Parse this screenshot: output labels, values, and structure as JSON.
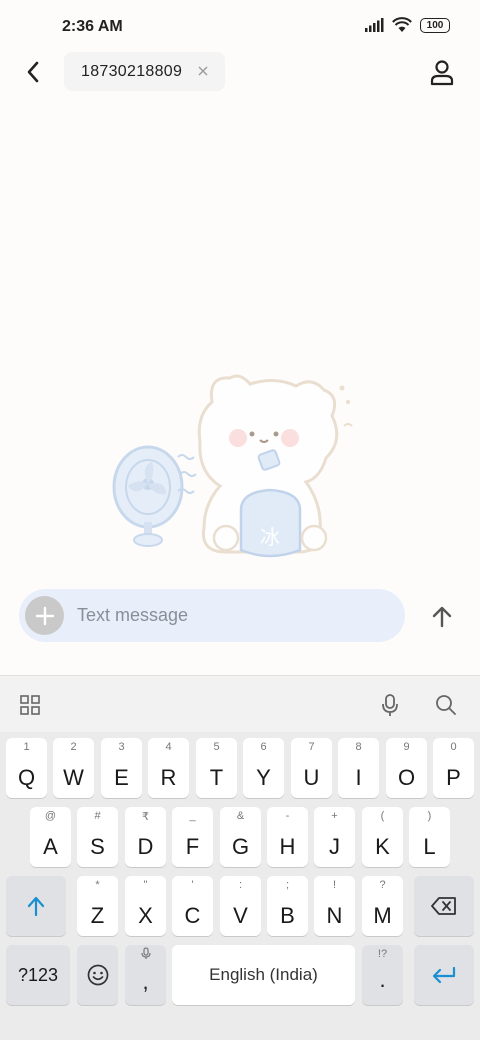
{
  "status_bar": {
    "time": "2:36 AM",
    "battery": "100"
  },
  "header": {
    "recipient": "18730218809",
    "icons": {
      "back": "back-arrow-icon",
      "chip_close": "close-icon",
      "contact": "person-icon"
    }
  },
  "compose": {
    "placeholder": "Text message",
    "icons": {
      "add": "plus-icon",
      "send": "send-arrow-icon"
    }
  },
  "keyboard": {
    "toolbar_icons": [
      "grid-icon",
      "microphone-icon",
      "search-icon"
    ],
    "row1": [
      {
        "hint": "1",
        "key": "Q"
      },
      {
        "hint": "2",
        "key": "W"
      },
      {
        "hint": "3",
        "key": "E"
      },
      {
        "hint": "4",
        "key": "R"
      },
      {
        "hint": "5",
        "key": "T"
      },
      {
        "hint": "6",
        "key": "Y"
      },
      {
        "hint": "7",
        "key": "U"
      },
      {
        "hint": "8",
        "key": "I"
      },
      {
        "hint": "9",
        "key": "O"
      },
      {
        "hint": "0",
        "key": "P"
      }
    ],
    "row2": [
      {
        "hint": "@",
        "key": "A"
      },
      {
        "hint": "#",
        "key": "S"
      },
      {
        "hint": "₹",
        "key": "D"
      },
      {
        "hint": "_",
        "key": "F"
      },
      {
        "hint": "&",
        "key": "G"
      },
      {
        "hint": "-",
        "key": "H"
      },
      {
        "hint": "+",
        "key": "J"
      },
      {
        "hint": "(",
        "key": "K"
      },
      {
        "hint": ")",
        "key": "L"
      }
    ],
    "row3": [
      {
        "hint": "*",
        "key": "Z"
      },
      {
        "hint": "\"",
        "key": "X"
      },
      {
        "hint": "'",
        "key": "C"
      },
      {
        "hint": ":",
        "key": "V"
      },
      {
        "hint": ";",
        "key": "B"
      },
      {
        "hint": "!",
        "key": "N"
      },
      {
        "hint": "?",
        "key": "M"
      }
    ],
    "symbols_key": "?123",
    "comma_key": ",",
    "space_label": "English (India)",
    "period_key": ".",
    "period_hint": "!?",
    "accent_color": "#1a8fd1"
  }
}
